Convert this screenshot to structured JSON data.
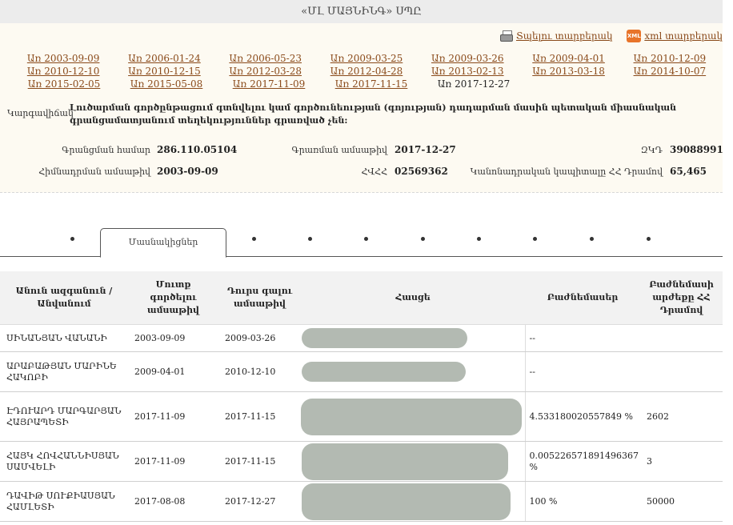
{
  "header": {
    "title": "«ՄԼ ՄԱՅՆԻՆԳ» ՍՊԸ"
  },
  "exports": {
    "print_label": "Տպելու տարբերակ",
    "xml_label": "xml տարբերակ",
    "xml_badge": "XML"
  },
  "dates": [
    [
      "Առ 2003-09-09",
      "Առ 2006-01-24",
      "Առ 2006-05-23",
      "Առ 2009-03-25",
      "Առ 2009-03-26",
      "Առ 2009-04-01",
      "Առ 2010-12-09"
    ],
    [
      "Առ 2010-12-10",
      "Առ 2010-12-15",
      "Առ 2012-03-28",
      "Առ 2012-04-28",
      "Առ 2013-02-13",
      "Առ 2013-03-18",
      "Առ 2014-10-07"
    ],
    [
      "Առ 2015-02-05",
      "Առ 2015-05-08",
      "Առ 2017-11-09",
      "Առ 2017-11-15",
      "Առ 2017-12-27"
    ]
  ],
  "selected_date": "Առ 2017-12-27",
  "status": {
    "label": "Կարգավիճակ",
    "text": "Լուծարման գործընթացում գտնվելու կամ գործունեության (գոյության) դադարման մասին պետական միասնական գրանցամատյանում տեղեկություններ գրառված չեն:"
  },
  "info": {
    "reg_number_label": "Գրանցման համար",
    "reg_number": "286.110.05104",
    "record_date_label": "Գրառման ամսաթիվ",
    "record_date": "2017-12-27",
    "tin_label": "ՀՎՀՀ",
    "tin": "02569362",
    "foundation_date_label": "Հիմնադրման ամսաթիվ",
    "foundation_date": "2003-09-09",
    "zkd_label": "ԶԿԴ",
    "zkd": "39088991",
    "capital_label": "Կանոնադրական կապիտալը ՀՀ Դրամով",
    "capital": "65,465"
  },
  "tabs": {
    "active_label": "Մասնակիցներ"
  },
  "table": {
    "headers": [
      "Անուն ազգանուն / Անվանում",
      "Մուտք գործելու ամսաթիվ",
      "Դուրս գալու ամսաթիվ",
      "Հասցե",
      "Բաժնեմասեր",
      "Բաժնեմասի արժեքը ՀՀ Դրամով"
    ],
    "rows": [
      {
        "name": "ՍԻՆԱՆՅԱՆ ՎԱՆԱՆԻ",
        "entry": "2003-09-09",
        "exit": "2009-03-26",
        "share": "--",
        "value": ""
      },
      {
        "name": "ԱՐԱԲԱԹՅԱՆ ՄԱՐԻՆԵ ՀԱԿՈԲԻ",
        "entry": "2009-04-01",
        "exit": "2010-12-10",
        "share": "--",
        "value": ""
      },
      {
        "name": "ԷԴՈՒԱՐԴ ՄԱՐԳԱՐՅԱՆ ՀԱՅՐԱՊԵՏԻ",
        "entry": "2017-11-09",
        "exit": "2017-11-15",
        "share": "4.533180020557849 %",
        "value": "2602"
      },
      {
        "name": "ՀԱՅԿ ՀՈՎՀԱՆՆԻՍՅԱՆ ՍԱՄՎԵԼԻ",
        "entry": "2017-11-09",
        "exit": "2017-11-15",
        "share": "0.005226571891496367 %",
        "value": "3"
      },
      {
        "name": "ԴԱՎԻԹ ՍՈՒՔԻԱՍՅԱՆ ՀԱՄԼԵՏԻ",
        "entry": "2017-08-08",
        "exit": "2017-12-27",
        "share": "100 %",
        "value": "50000"
      }
    ]
  }
}
